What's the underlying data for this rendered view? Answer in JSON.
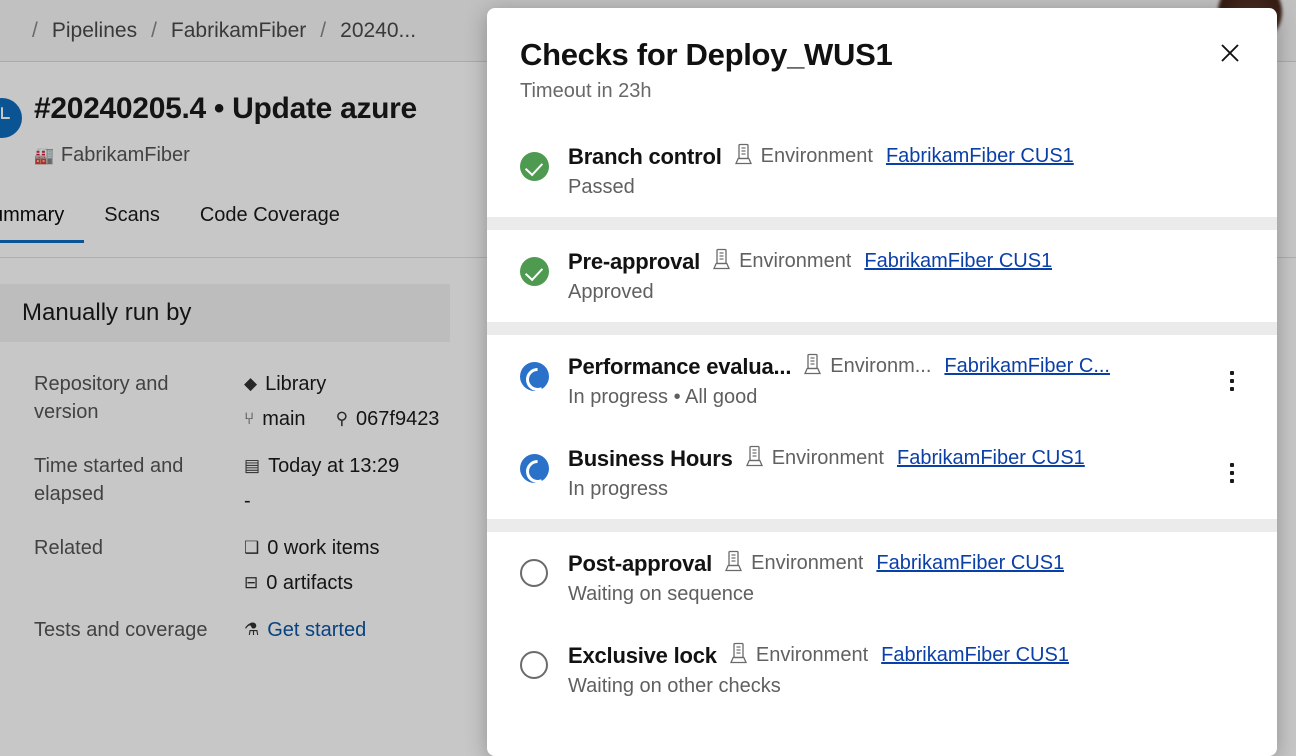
{
  "background": {
    "breadcrumb": {
      "items": [
        "Pipelines",
        "FabrikamFiber",
        "20240..."
      ],
      "separator": "/"
    },
    "run": {
      "title": "#20240205.4 • Update azure",
      "pipeline_name": "FabrikamFiber",
      "pipeline_icon": "factory-icon",
      "status_icon": "clock-running-icon"
    },
    "tabs": [
      {
        "label": "ummary",
        "active": true
      },
      {
        "label": "Scans",
        "active": false
      },
      {
        "label": "Code Coverage",
        "active": false
      }
    ],
    "summary_card": {
      "title": "Manually run by",
      "rows": [
        {
          "key": "Repository and version",
          "lines": [
            {
              "icon": "repository-icon",
              "glyph": "◆",
              "text": "Library",
              "link": false
            },
            {
              "icon": "branch-icon",
              "glyph": "⑂",
              "text": "main",
              "link": false,
              "extra_icon": "commit-icon",
              "extra_glyph": "⚲",
              "extra_text": "067f9423"
            }
          ]
        },
        {
          "key": "Time started and elapsed",
          "lines": [
            {
              "icon": "calendar-icon",
              "glyph": "▤",
              "text": "Today at 13:29",
              "link": false
            },
            {
              "icon": "",
              "glyph": "",
              "text": "-",
              "link": false
            }
          ]
        },
        {
          "key": "Related",
          "lines": [
            {
              "icon": "work-items-icon",
              "glyph": "❑",
              "text": "0 work items",
              "link": false
            },
            {
              "icon": "artifacts-icon",
              "glyph": "⊟",
              "text": "0 artifacts",
              "link": false
            }
          ]
        },
        {
          "key": "Tests and coverage",
          "lines": [
            {
              "icon": "test-beaker-icon",
              "glyph": "⚗",
              "text": "Get started",
              "link": true
            }
          ]
        }
      ]
    }
  },
  "modal": {
    "title": "Checks for Deploy_WUS1",
    "subtitle": "Timeout in 23h",
    "close_icon": "close-icon",
    "environment_icon": "environment-server-icon",
    "overflow_icon": "more-vertical-icon",
    "colors": {
      "pass": "#4e9a51",
      "in_progress": "#2a71c9",
      "waiting_border": "#6b6b6b",
      "link": "#0b3fa8",
      "separator": "#ebebeb"
    },
    "groups": [
      {
        "checks": [
          {
            "name": "Branch control",
            "env_label": "Environment",
            "env_link": "FabrikamFiber CUS1",
            "status": "Passed",
            "state": "pass",
            "has_menu": false,
            "truncated": false
          }
        ]
      },
      {
        "checks": [
          {
            "name": "Pre-approval",
            "env_label": "Environment",
            "env_link": "FabrikamFiber CUS1",
            "status": "Approved",
            "state": "pass",
            "has_menu": false,
            "truncated": false
          }
        ]
      },
      {
        "checks": [
          {
            "name": "Performance evalua...",
            "env_label": "Environm...",
            "env_link": "FabrikamFiber C...",
            "status": "In progress • All good",
            "state": "in_progress",
            "has_menu": true,
            "truncated": true
          },
          {
            "name": "Business Hours",
            "env_label": "Environment",
            "env_link": "FabrikamFiber CUS1",
            "status": "In progress",
            "state": "in_progress",
            "has_menu": true,
            "truncated": false
          }
        ]
      },
      {
        "checks": [
          {
            "name": "Post-approval",
            "env_label": "Environment",
            "env_link": "FabrikamFiber CUS1",
            "status": "Waiting on sequence",
            "state": "waiting",
            "has_menu": false,
            "truncated": false
          },
          {
            "name": "Exclusive lock",
            "env_label": "Environment",
            "env_link": "FabrikamFiber CUS1",
            "status": "Waiting on other checks",
            "state": "waiting",
            "has_menu": false,
            "truncated": false
          }
        ]
      }
    ]
  }
}
